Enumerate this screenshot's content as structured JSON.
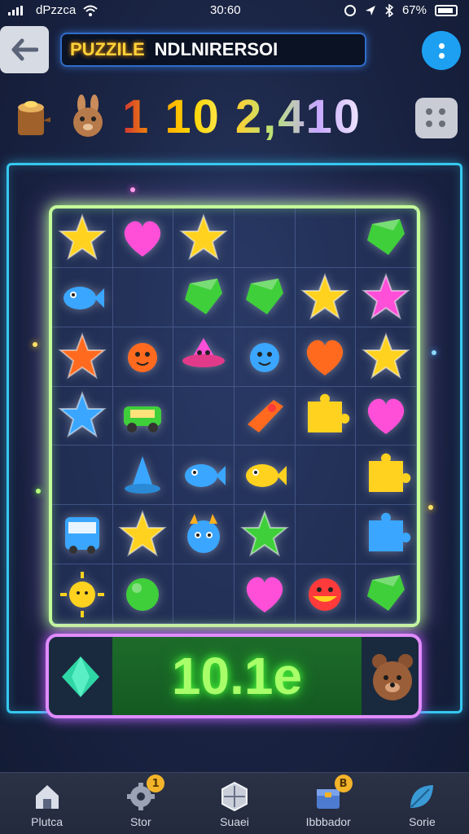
{
  "status_bar": {
    "carrier": "dPzzca",
    "time": "30:60",
    "battery": "67%"
  },
  "header": {
    "title_prefix": "PUZZILE",
    "title_text": "NDLNIRERSOI"
  },
  "score": {
    "part1": "1 10",
    "part2": "2,410"
  },
  "board": {
    "rows": [
      [
        "star-yellow",
        "heart-pink",
        "star-yellow",
        "empty",
        "empty",
        "gem-green"
      ],
      [
        "fish-blue",
        "empty",
        "gem-green",
        "gem-green",
        "star-yellow",
        "star-pink"
      ],
      [
        "star-orange",
        "critter-orange",
        "ufo-pink",
        "critter-blue",
        "heart-orange",
        "star-yellow"
      ],
      [
        "star-blue",
        "car-green",
        "empty",
        "rocket-orange",
        "puzzle-yellow",
        "heart-pink"
      ],
      [
        "empty",
        "hat-blue",
        "fish-blue",
        "fish-yellow",
        "empty",
        "puzzle-yellow"
      ],
      [
        "bus-blue",
        "star-yellow",
        "monster-blue",
        "star-green",
        "empty",
        "puzzle-blue"
      ],
      [
        "sun-yellow",
        "ball-green",
        "empty",
        "heart-pink",
        "face-red",
        "gem-green"
      ]
    ],
    "colors": {
      "yellow": "#ffd21f",
      "pink": "#ff4fd8",
      "green": "#3fcf3a",
      "blue": "#3aa6ff",
      "orange": "#ff6a1f",
      "red": "#ff3a3a"
    }
  },
  "bottom": {
    "value": "10.1e"
  },
  "tabs": [
    {
      "label": "Plutca",
      "icon": "home-icon",
      "badge": ""
    },
    {
      "label": "Stor",
      "icon": "gear-icon",
      "badge": "1"
    },
    {
      "label": "Suaei",
      "icon": "shield-icon",
      "badge": ""
    },
    {
      "label": "Ibbbador",
      "icon": "box-icon",
      "badge": "B"
    },
    {
      "label": "Sorie",
      "icon": "leaf-icon",
      "badge": ""
    }
  ]
}
